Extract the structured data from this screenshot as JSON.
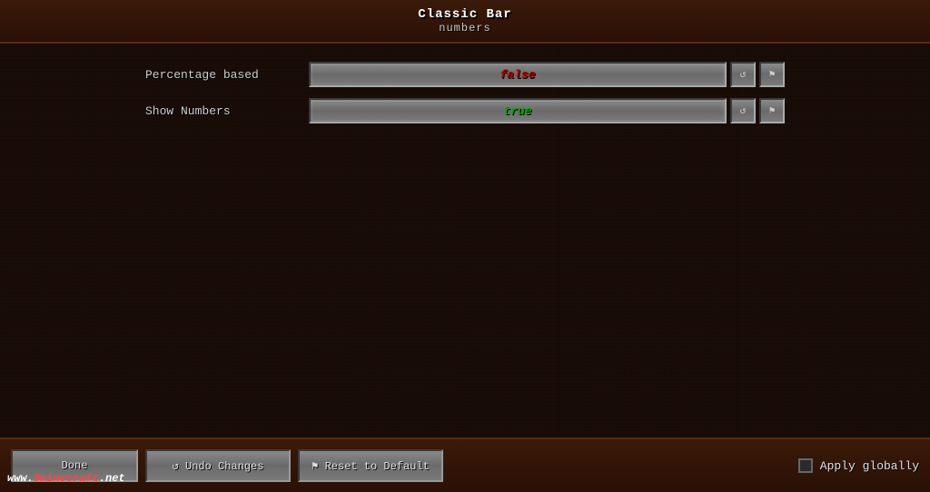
{
  "header": {
    "title_main": "Classic Bar",
    "title_sub": "numbers"
  },
  "settings": {
    "rows": [
      {
        "label": "Percentage based",
        "value": "false",
        "value_type": "false",
        "reset_icon": "↺",
        "pin_icon": "⚑"
      },
      {
        "label": "Show Numbers",
        "value": "true",
        "value_type": "true",
        "reset_icon": "↺",
        "pin_icon": "⚑"
      }
    ]
  },
  "footer": {
    "done_label": "Done",
    "undo_label": "↺ Undo Changes",
    "reset_label": "⚑ Reset to Default",
    "apply_globally_label": "Apply globally",
    "apply_globally_checked": false
  },
  "watermark": {
    "text": "www.9minecraft.net"
  },
  "colors": {
    "false_color": "#aa0000",
    "true_color": "#00aa00"
  }
}
